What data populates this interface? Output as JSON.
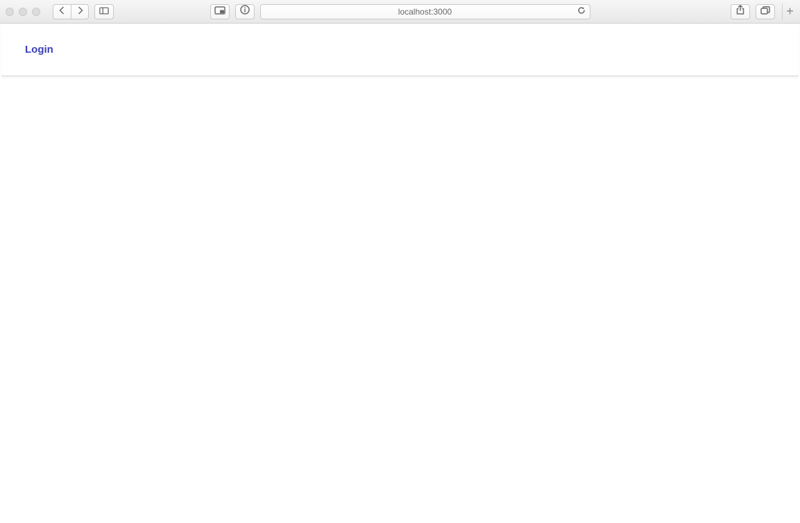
{
  "browser": {
    "url": "localhost:3000"
  },
  "page": {
    "navbar": {
      "login_label": "Login"
    }
  }
}
